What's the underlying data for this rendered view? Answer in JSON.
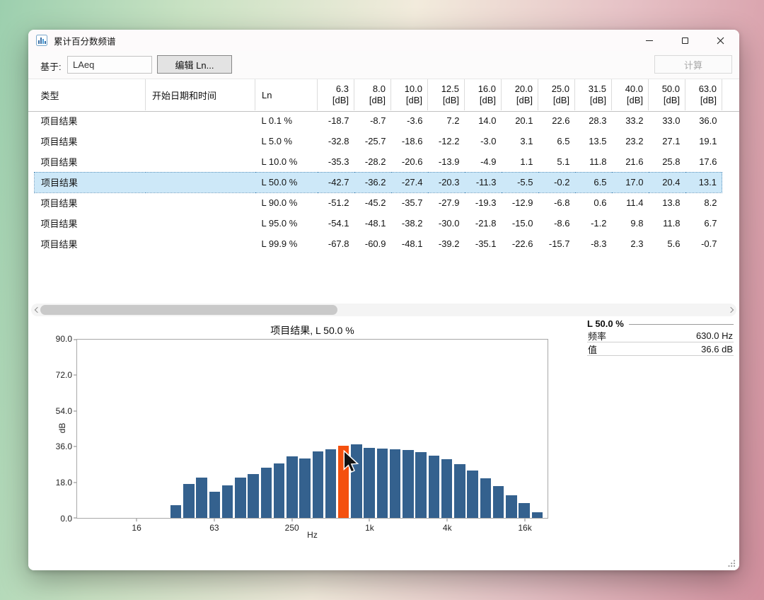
{
  "window": {
    "title": "累计百分数频谱"
  },
  "toolbar": {
    "based_on_label": "基于:",
    "based_on_value": "LAeq",
    "edit_ln_button": "编辑 Ln...",
    "calculate_button": "计算"
  },
  "table": {
    "text_columns": [
      "类型",
      "开始日期和时间",
      "Ln"
    ],
    "freq_columns": [
      "6.3",
      "8.0",
      "10.0",
      "12.5",
      "16.0",
      "20.0",
      "25.0",
      "31.5",
      "40.0",
      "50.0",
      "63.0"
    ],
    "freq_unit": "[dB]",
    "rows": [
      {
        "type": "项目结果",
        "start_datetime": "",
        "ln": "L 0.1 %",
        "selected": false,
        "values": [
          "-18.7",
          "-8.7",
          "-3.6",
          "7.2",
          "14.0",
          "20.1",
          "22.6",
          "28.3",
          "33.2",
          "33.0",
          "36.0"
        ]
      },
      {
        "type": "项目结果",
        "start_datetime": "",
        "ln": "L 5.0 %",
        "selected": false,
        "values": [
          "-32.8",
          "-25.7",
          "-18.6",
          "-12.2",
          "-3.0",
          "3.1",
          "6.5",
          "13.5",
          "23.2",
          "27.1",
          "19.1"
        ]
      },
      {
        "type": "项目结果",
        "start_datetime": "",
        "ln": "L 10.0 %",
        "selected": false,
        "values": [
          "-35.3",
          "-28.2",
          "-20.6",
          "-13.9",
          "-4.9",
          "1.1",
          "5.1",
          "11.8",
          "21.6",
          "25.8",
          "17.6"
        ]
      },
      {
        "type": "项目结果",
        "start_datetime": "",
        "ln": "L 50.0 %",
        "selected": true,
        "values": [
          "-42.7",
          "-36.2",
          "-27.4",
          "-20.3",
          "-11.3",
          "-5.5",
          "-0.2",
          "6.5",
          "17.0",
          "20.4",
          "13.1"
        ]
      },
      {
        "type": "项目结果",
        "start_datetime": "",
        "ln": "L 90.0 %",
        "selected": false,
        "values": [
          "-51.2",
          "-45.2",
          "-35.7",
          "-27.9",
          "-19.3",
          "-12.9",
          "-6.8",
          "0.6",
          "11.4",
          "13.8",
          "8.2"
        ]
      },
      {
        "type": "项目结果",
        "start_datetime": "",
        "ln": "L 95.0 %",
        "selected": false,
        "values": [
          "-54.1",
          "-48.1",
          "-38.2",
          "-30.0",
          "-21.8",
          "-15.0",
          "-8.6",
          "-1.2",
          "9.8",
          "11.8",
          "6.7"
        ]
      },
      {
        "type": "项目结果",
        "start_datetime": "",
        "ln": "L 99.9 %",
        "selected": false,
        "values": [
          "-67.8",
          "-60.9",
          "-48.1",
          "-39.2",
          "-35.1",
          "-22.6",
          "-15.7",
          "-8.3",
          "2.3",
          "5.6",
          "-0.7"
        ]
      }
    ]
  },
  "chart_data": {
    "type": "bar",
    "title": "项目结果, L 50.0 %",
    "xlabel": "Hz",
    "ylabel": "dB",
    "ylim": [
      0,
      90
    ],
    "grid": false,
    "y_ticks": [
      {
        "label": "0.0",
        "value": 0
      },
      {
        "label": "18.0",
        "value": 18
      },
      {
        "label": "36.0",
        "value": 36
      },
      {
        "label": "54.0",
        "value": 54
      },
      {
        "label": "72.0",
        "value": 72
      },
      {
        "label": "90.0",
        "value": 90
      }
    ],
    "x_ticks": [
      {
        "label": "16",
        "freq": 16
      },
      {
        "label": "63",
        "freq": 63
      },
      {
        "label": "250",
        "freq": 250
      },
      {
        "label": "1k",
        "freq": 1000
      },
      {
        "label": "4k",
        "freq": 4000
      },
      {
        "label": "16k",
        "freq": 16000
      }
    ],
    "frequencies": [
      6.3,
      8,
      10,
      12.5,
      16,
      20,
      25,
      31.5,
      40,
      50,
      63,
      80,
      100,
      125,
      160,
      200,
      250,
      315,
      400,
      500,
      630,
      800,
      1000,
      1250,
      1600,
      2000,
      2500,
      3150,
      4000,
      5000,
      6300,
      8000,
      10000,
      12500,
      16000,
      20000
    ],
    "values": [
      -42.7,
      -36.2,
      -27.4,
      -20.3,
      -11.3,
      -5.5,
      -0.2,
      6.5,
      17.0,
      20.4,
      13.1,
      16.5,
      20.5,
      22.0,
      25.5,
      27.5,
      31.0,
      30.0,
      33.5,
      34.5,
      36.6,
      37.3,
      35.3,
      35.0,
      34.7,
      34.3,
      33.2,
      31.5,
      29.5,
      27.0,
      24.0,
      20.0,
      16.0,
      11.5,
      7.5,
      3.0
    ],
    "highlight_frequency": 630,
    "bar_color": "#34618e",
    "highlight_color": "#f4500e"
  },
  "info_panel": {
    "header": "L 50.0 %",
    "rows": [
      {
        "label": "频率",
        "value": "630.0 Hz"
      },
      {
        "label": "值",
        "value": "36.6 dB"
      }
    ]
  }
}
